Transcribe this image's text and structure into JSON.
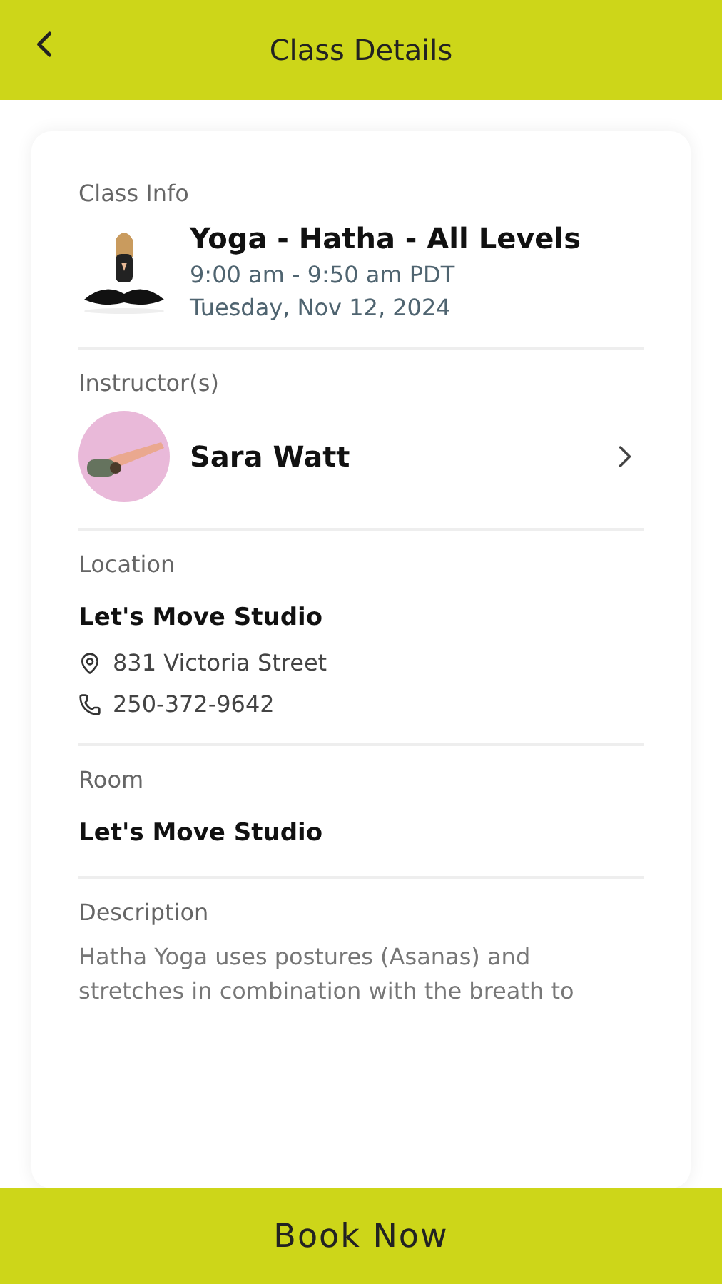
{
  "header": {
    "title": "Class Details"
  },
  "class_info": {
    "label": "Class Info",
    "name": "Yoga - Hatha - All Levels",
    "time": "9:00 am - 9:50 am PDT",
    "date": "Tuesday, Nov 12, 2024"
  },
  "instructors": {
    "label": "Instructor(s)",
    "items": [
      {
        "name": "Sara Watt"
      }
    ]
  },
  "location": {
    "label": "Location",
    "name": "Let's Move Studio",
    "address": "831 Victoria Street",
    "phone": "250-372-9642"
  },
  "room": {
    "label": "Room",
    "name": "Let's Move Studio"
  },
  "description": {
    "label": "Description",
    "text": "Hatha Yoga uses postures (Asanas) and stretches in combination with the breath to"
  },
  "book_button": "Book Now"
}
